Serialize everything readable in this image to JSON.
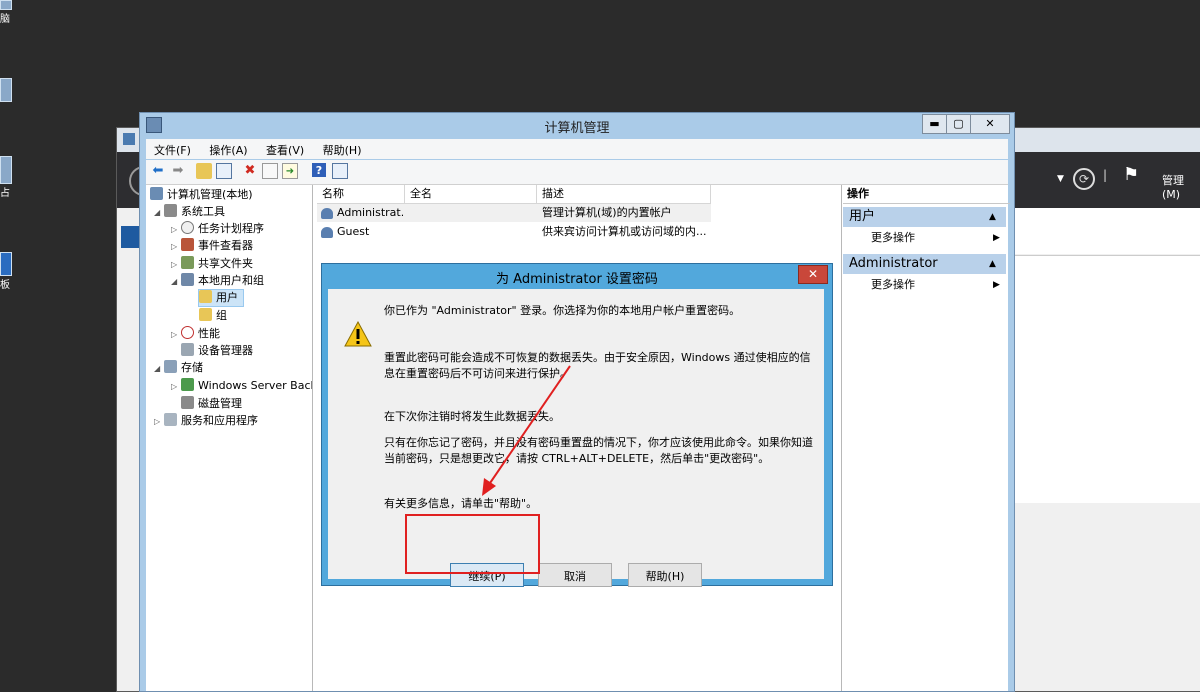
{
  "desktop": {
    "labels": [
      "脑",
      "占",
      "板"
    ]
  },
  "background_window": {
    "menu_label": "管理(M)"
  },
  "window": {
    "title": "计算机管理",
    "minimize": "▬",
    "maximize": "▢",
    "close": "✕"
  },
  "menu": {
    "file": "文件(F)",
    "action": "操作(A)",
    "view": "查看(V)",
    "help": "帮助(H)"
  },
  "toolbar": {
    "icons": [
      "back-arrow-icon",
      "forward-arrow-icon",
      "up-folder-icon",
      "show-hide-tree-icon",
      "delete-icon",
      "properties-icon",
      "export-icon",
      "help-icon",
      "console-icon"
    ]
  },
  "tree": {
    "root": "计算机管理(本地)",
    "system_tools": "系统工具",
    "task_scheduler": "任务计划程序",
    "event_viewer": "事件查看器",
    "shared_folders": "共享文件夹",
    "local_users_groups": "本地用户和组",
    "users": "用户",
    "groups": "组",
    "performance": "性能",
    "device_manager": "设备管理器",
    "storage": "存储",
    "windows_server_backup": "Windows Server Back",
    "disk_management": "磁盘管理",
    "services_apps": "服务和应用程序"
  },
  "list": {
    "columns": [
      "名称",
      "全名",
      "描述"
    ],
    "rows": [
      {
        "name": "Administrat...",
        "fullname": "",
        "desc": "管理计算机(域)的内置帐户"
      },
      {
        "name": "Guest",
        "fullname": "",
        "desc": "供来宾访问计算机或访问域的内..."
      }
    ]
  },
  "actions": {
    "header": "操作",
    "section1": "用户",
    "more1": "更多操作",
    "section2": "Administrator",
    "more2": "更多操作"
  },
  "dialog": {
    "title": "为 Administrator 设置密码",
    "close": "✕",
    "p1": "你已作为 \"Administrator\" 登录。你选择为你的本地用户帐户重置密码。",
    "p2": "重置此密码可能会造成不可恢复的数据丢失。由于安全原因，Windows 通过使相应的信息在重置密码后不可访问来进行保护。",
    "p3": "在下次你注销时将发生此数据丢失。",
    "p4": "只有在你忘记了密码，并且没有密码重置盘的情况下，你才应该使用此命令。如果你知道当前密码，只是想更改它，请按 CTRL+ALT+DELETE，然后单击\"更改密码\"。",
    "p5": "有关更多信息，请单击\"帮助\"。",
    "btn_continue": "继续(P)",
    "btn_cancel": "取消",
    "btn_help": "帮助(H)"
  },
  "colors": {
    "dialog_frame": "#52a8dc",
    "annotation": "#e02020",
    "action_section": "#b9d1ea"
  }
}
